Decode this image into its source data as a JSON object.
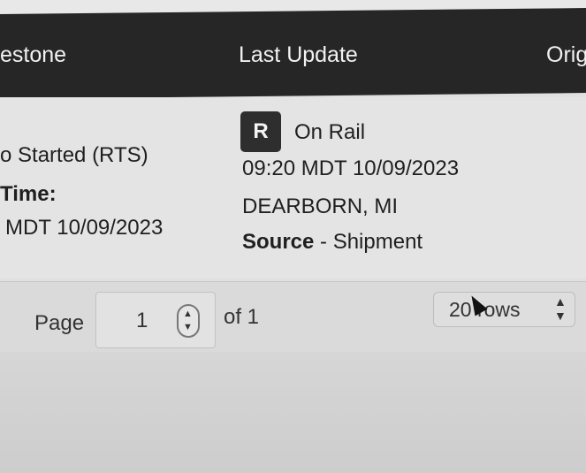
{
  "table": {
    "headers": [
      "estone",
      "Last Update",
      "Orig"
    ],
    "milestone": {
      "status": "o Started (RTS)",
      "time_label": "Time:",
      "time_value": "MDT 10/09/2023"
    },
    "last_update": {
      "badge": "R",
      "status": "On Rail",
      "timestamp": "09:20 MDT 10/09/2023",
      "location": "DEARBORN, MI",
      "source_label": "Source",
      "source_value": " - Shipment"
    }
  },
  "pagination": {
    "page_label": "Page",
    "page_value": "1",
    "of_label": "of 1",
    "rows_select": "20 rows"
  },
  "icons": {
    "stepper": "up-down-chevron-icon",
    "select": "sort-caret-icon",
    "cursor": "mouse-pointer-icon"
  }
}
